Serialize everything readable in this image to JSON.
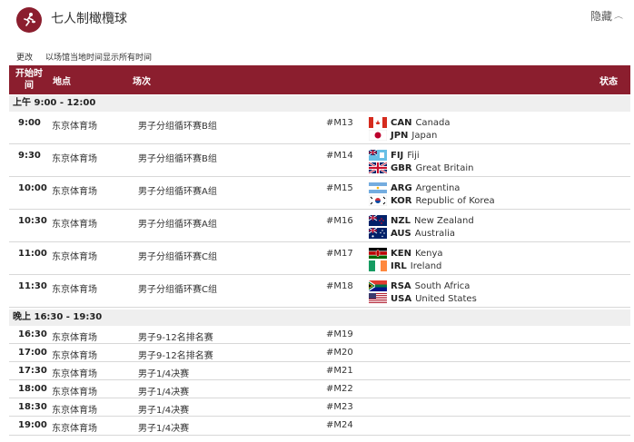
{
  "sport": {
    "title": "七人制橄欖球",
    "icon": "rugby-player-icon"
  },
  "toggle": {
    "label": "隐藏"
  },
  "timezone": {
    "change_label": "更改",
    "info": "以场馆当地时间显示所有时间"
  },
  "columns": {
    "time": "开始时间",
    "venue": "地点",
    "event": "场次",
    "status": "状态"
  },
  "colors": {
    "accent": "#8b1e2e",
    "period_bg": "#efefef"
  },
  "periods": [
    {
      "label": "上午  9:00 - 12:00"
    },
    {
      "label": "晚上  16:30 - 19:30"
    }
  ],
  "matches": [
    {
      "time": "9:00",
      "venue": "东京体育场",
      "event": "男子分组循环赛B组",
      "code": "#M13",
      "teams": [
        {
          "code": "CAN",
          "name": "Canada"
        },
        {
          "code": "JPN",
          "name": "Japan"
        }
      ]
    },
    {
      "time": "9:30",
      "venue": "东京体育场",
      "event": "男子分组循环赛B组",
      "code": "#M14",
      "teams": [
        {
          "code": "FIJ",
          "name": "Fiji"
        },
        {
          "code": "GBR",
          "name": "Great Britain"
        }
      ]
    },
    {
      "time": "10:00",
      "venue": "东京体育场",
      "event": "男子分组循环赛A组",
      "code": "#M15",
      "teams": [
        {
          "code": "ARG",
          "name": "Argentina"
        },
        {
          "code": "KOR",
          "name": "Republic of Korea"
        }
      ]
    },
    {
      "time": "10:30",
      "venue": "东京体育场",
      "event": "男子分组循环赛A组",
      "code": "#M16",
      "teams": [
        {
          "code": "NZL",
          "name": "New Zealand"
        },
        {
          "code": "AUS",
          "name": "Australia"
        }
      ]
    },
    {
      "time": "11:00",
      "venue": "东京体育场",
      "event": "男子分组循环赛C组",
      "code": "#M17",
      "teams": [
        {
          "code": "KEN",
          "name": "Kenya"
        },
        {
          "code": "IRL",
          "name": "Ireland"
        }
      ]
    },
    {
      "time": "11:30",
      "venue": "东京体育场",
      "event": "男子分组循环赛C组",
      "code": "#M18",
      "teams": [
        {
          "code": "RSA",
          "name": "South Africa"
        },
        {
          "code": "USA",
          "name": "United States"
        }
      ]
    },
    {
      "time": "16:30",
      "venue": "东京体育场",
      "event": "男子9-12名排名赛",
      "code": "#M19"
    },
    {
      "time": "17:00",
      "venue": "东京体育场",
      "event": "男子9-12名排名赛",
      "code": "#M20"
    },
    {
      "time": "17:30",
      "venue": "东京体育场",
      "event": "男子1/4决赛",
      "code": "#M21"
    },
    {
      "time": "18:00",
      "venue": "东京体育场",
      "event": "男子1/4决赛",
      "code": "#M22"
    },
    {
      "time": "18:30",
      "venue": "东京体育场",
      "event": "男子1/4决赛",
      "code": "#M23"
    },
    {
      "time": "19:00",
      "venue": "东京体育场",
      "event": "男子1/4决赛",
      "code": "#M24"
    }
  ]
}
